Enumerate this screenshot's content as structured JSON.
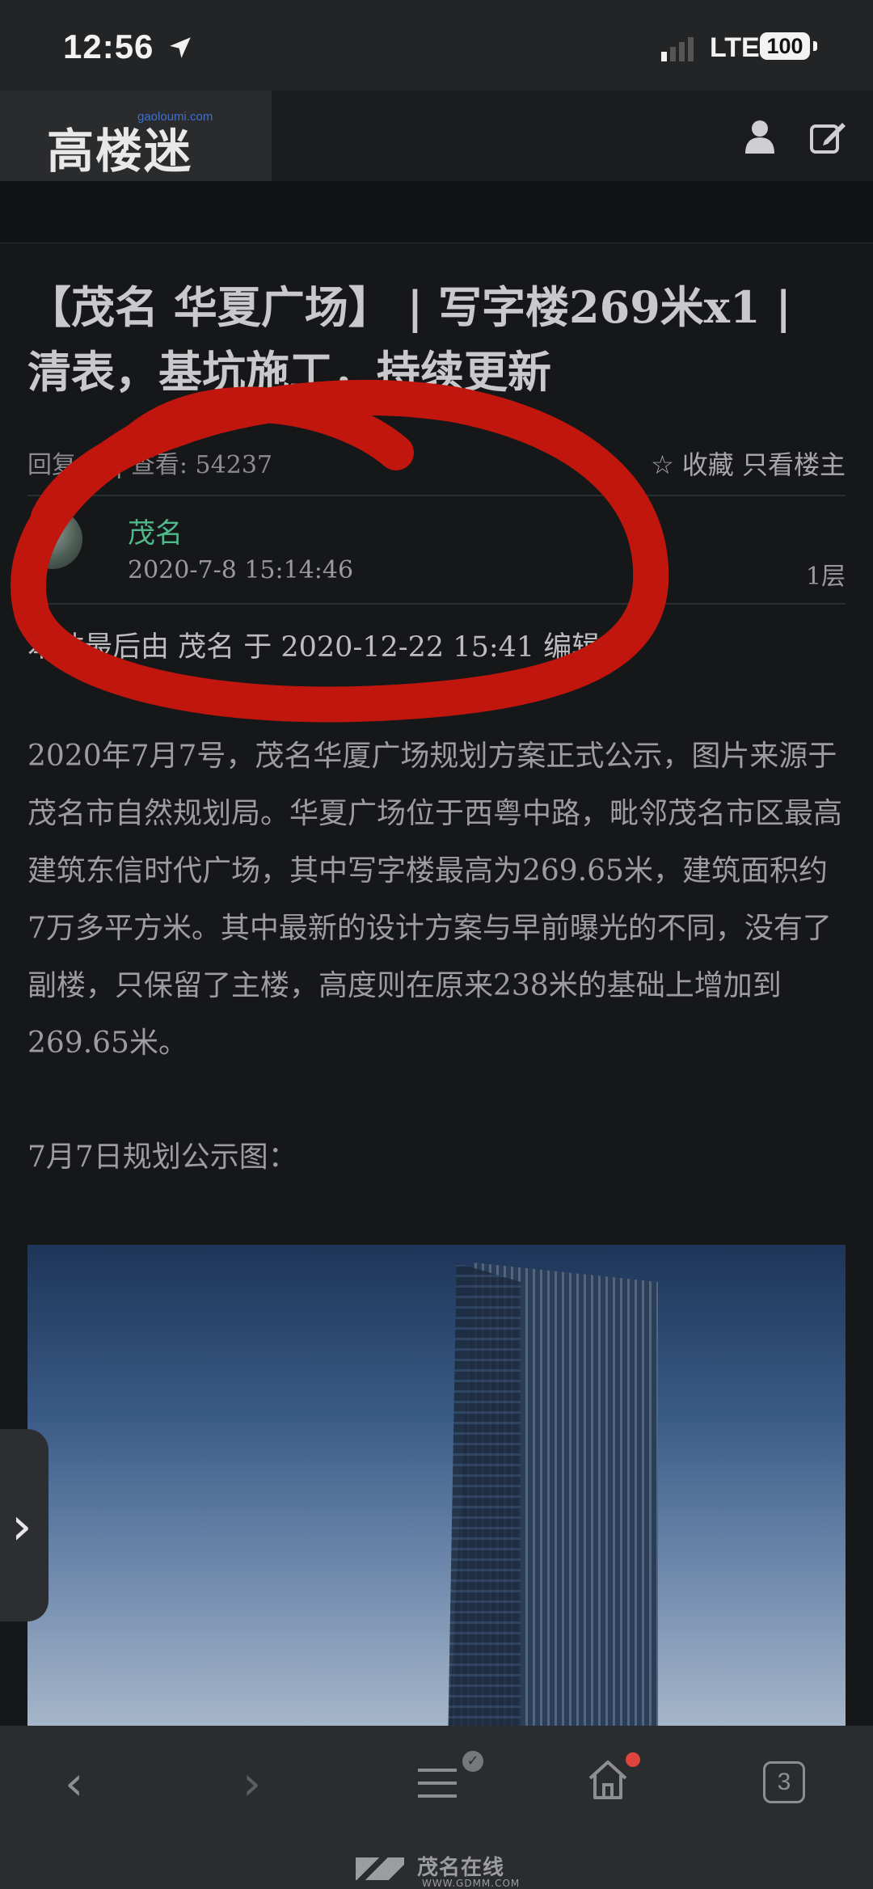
{
  "status_bar": {
    "time": "12:56",
    "network": "LTE",
    "battery": "100"
  },
  "header": {
    "logo_text": "高楼迷",
    "logo_domain": "gaoloumi.com"
  },
  "post": {
    "title": "【茂名 华夏广场】 | 写字楼269米x1 | 清表，基坑施工，持续更新",
    "meta_left": "回复: 1 | 查看: 54237",
    "favorite_label": "收藏",
    "only_author_label": "只看楼主",
    "author": "茂名",
    "date": "2020-7-8 15:14:46",
    "floor": "1层",
    "edited_note": "本帖最后由 茂名 于 2020-12-22 15:41 编辑",
    "body": "2020年7月7号，茂名华厦广场规划方案正式公示，图片来源于茂名市自然规划局。华夏广场位于西粤中路，毗邻茂名市区最高建筑东信时代广场，其中写字楼最高为269.65米，建筑面积约7万多平方米。其中最新的设计方案与早前曝光的不同，没有了副楼，只保留了主楼，高度则在原来238米的基础上增加到269.65米。",
    "image_caption": "7月7日规划公示图："
  },
  "side_tab": {
    "icon": "chevron-right-icon"
  },
  "bottom_bar": {
    "tab_count": "3",
    "watermark": "茂名在线",
    "watermark_url": "WWW.GDMM.COM"
  },
  "colors": {
    "accent_author": "#4fb98a",
    "annotation_red": "#c0160e",
    "background": "#111214"
  }
}
